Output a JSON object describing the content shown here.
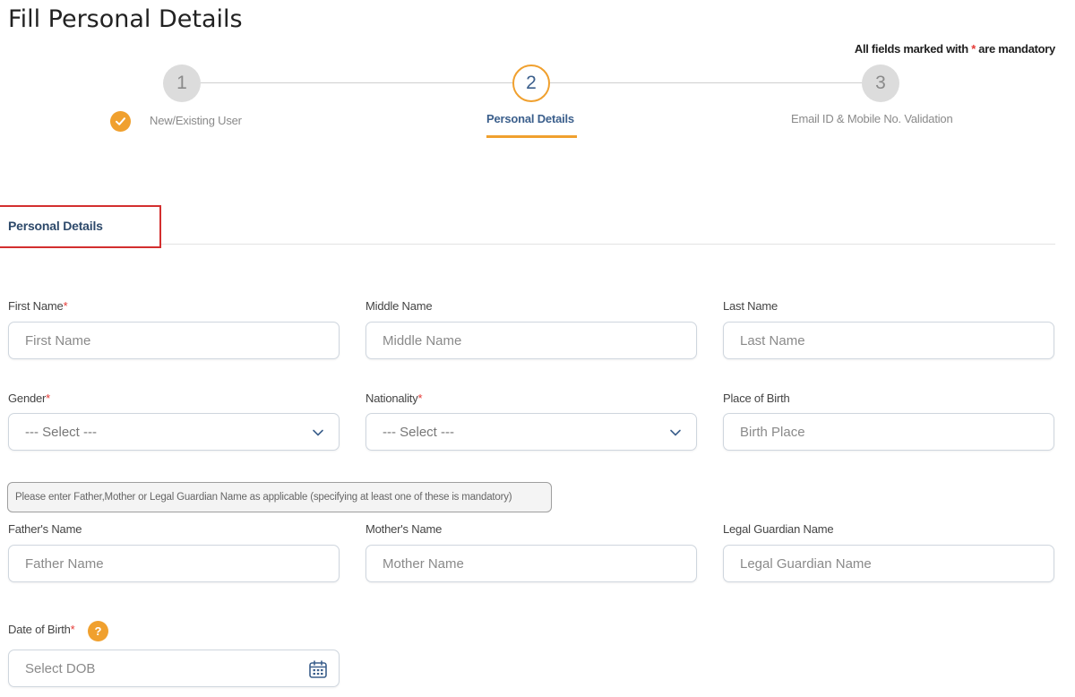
{
  "page": {
    "title": "Fill Personal Details"
  },
  "mandatory_note": {
    "prefix": "All fields marked with ",
    "star": "*",
    "suffix": " are mandatory"
  },
  "stepper": {
    "steps": [
      {
        "number": "1",
        "label": "New/Existing User",
        "state": "done"
      },
      {
        "number": "2",
        "label": "Personal Details",
        "state": "active"
      },
      {
        "number": "3",
        "label": "Email ID & Mobile No. Validation",
        "state": "todo"
      }
    ],
    "accent_color": "#f0a02e",
    "active_text_color": "#3b5f8c"
  },
  "section": {
    "title": "Personal Details"
  },
  "fields": {
    "first_name": {
      "label": "First Name",
      "required": "*",
      "placeholder": "First Name"
    },
    "middle_name": {
      "label": "Middle Name",
      "placeholder": "Middle Name"
    },
    "last_name": {
      "label": "Last Name",
      "placeholder": "Last Name"
    },
    "gender": {
      "label": "Gender",
      "required": "*",
      "value": "--- Select ---"
    },
    "nationality": {
      "label": "Nationality",
      "required": "*",
      "value": "--- Select ---"
    },
    "place_of_birth": {
      "label": "Place of Birth",
      "placeholder": "Birth Place"
    },
    "father_name": {
      "label": "Father's Name",
      "placeholder": "Father Name"
    },
    "mother_name": {
      "label": "Mother's Name",
      "placeholder": "Mother Name"
    },
    "guardian_name": {
      "label": "Legal Guardian Name",
      "placeholder": "Legal Guardian Name"
    },
    "dob": {
      "label": "Date of Birth",
      "required": "*",
      "placeholder": "Select DOB",
      "help": "?"
    }
  },
  "hint": {
    "text": "Please enter Father,Mother or Legal Guardian Name as applicable (specifying at least one of these is mandatory)"
  }
}
